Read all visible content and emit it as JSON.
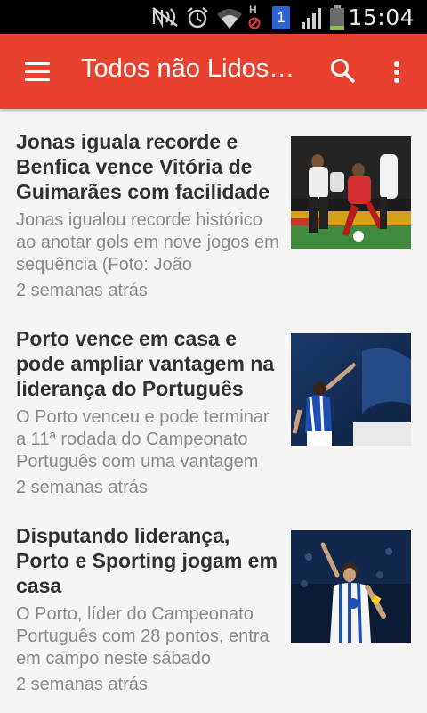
{
  "status_bar": {
    "time": "15:04",
    "icons": [
      "mute-icon",
      "alarm-icon",
      "wifi-icon",
      "hsdpa-icon",
      "sim-icon",
      "signal-icon",
      "battery-icon"
    ],
    "sim_label": "1",
    "network_label": "H"
  },
  "app_bar": {
    "title": "Todos não Lidos…",
    "color": "#e8412f",
    "icons": [
      "menu-icon",
      "search-icon",
      "more-vert-icon"
    ]
  },
  "articles": [
    {
      "title": "Jonas iguala recorde e Benfica vence Vitória de Guimarães com facilidade",
      "snippet": "Jonas igualou recorde histórico ao anotar gols em nove jogos em sequência (Foto: João",
      "time": "2 semanas atrás",
      "thumbnail": "soccer-benfica-photo"
    },
    {
      "title": "Porto vence em casa e pode ampliar vantagem na liderança do Português",
      "snippet": "O Porto venceu e pode terminar a 11ª rodada do Campeonato Português com uma vantagem",
      "time": "2 semanas atrás",
      "thumbnail": "soccer-porto-celebration-photo"
    },
    {
      "title": "Disputando liderança, Porto e Sporting jogam em casa",
      "snippet": "O Porto, líder do Campeonato Português com 28 pontos, entra em campo neste sábado",
      "time": "2 semanas atrás",
      "thumbnail": "soccer-porto-captain-photo"
    }
  ]
}
